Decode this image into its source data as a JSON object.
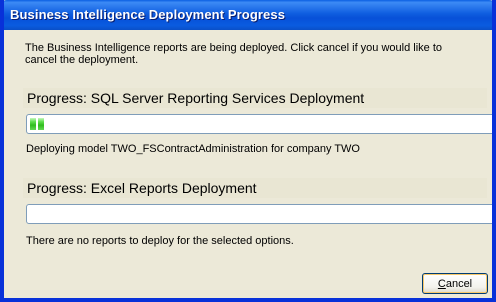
{
  "window": {
    "title": "Business Intelligence Deployment Progress"
  },
  "intro_text": "The Business Intelligence reports are being deployed.  Click cancel if you would like to cancel the deployment.",
  "sections": {
    "ssrs": {
      "header": "Progress: SQL Server Reporting Services Deployment",
      "progress_percent": 3,
      "status": "Deploying model TWO_FSContractAdministration for company TWO"
    },
    "excel": {
      "header": "Progress: Excel Reports Deployment",
      "progress_percent": 0,
      "status": "There are no reports to deploy for the selected options."
    }
  },
  "buttons": {
    "cancel": {
      "accesskey": "C",
      "label_rest": "ancel"
    }
  },
  "colors": {
    "title_bar": "#0a5ce0",
    "window_frame": "#0831d9",
    "dialog_background": "#ece9d8",
    "section_header_background": "#e9e6d3",
    "progress_fill": "#2fbd1d"
  }
}
